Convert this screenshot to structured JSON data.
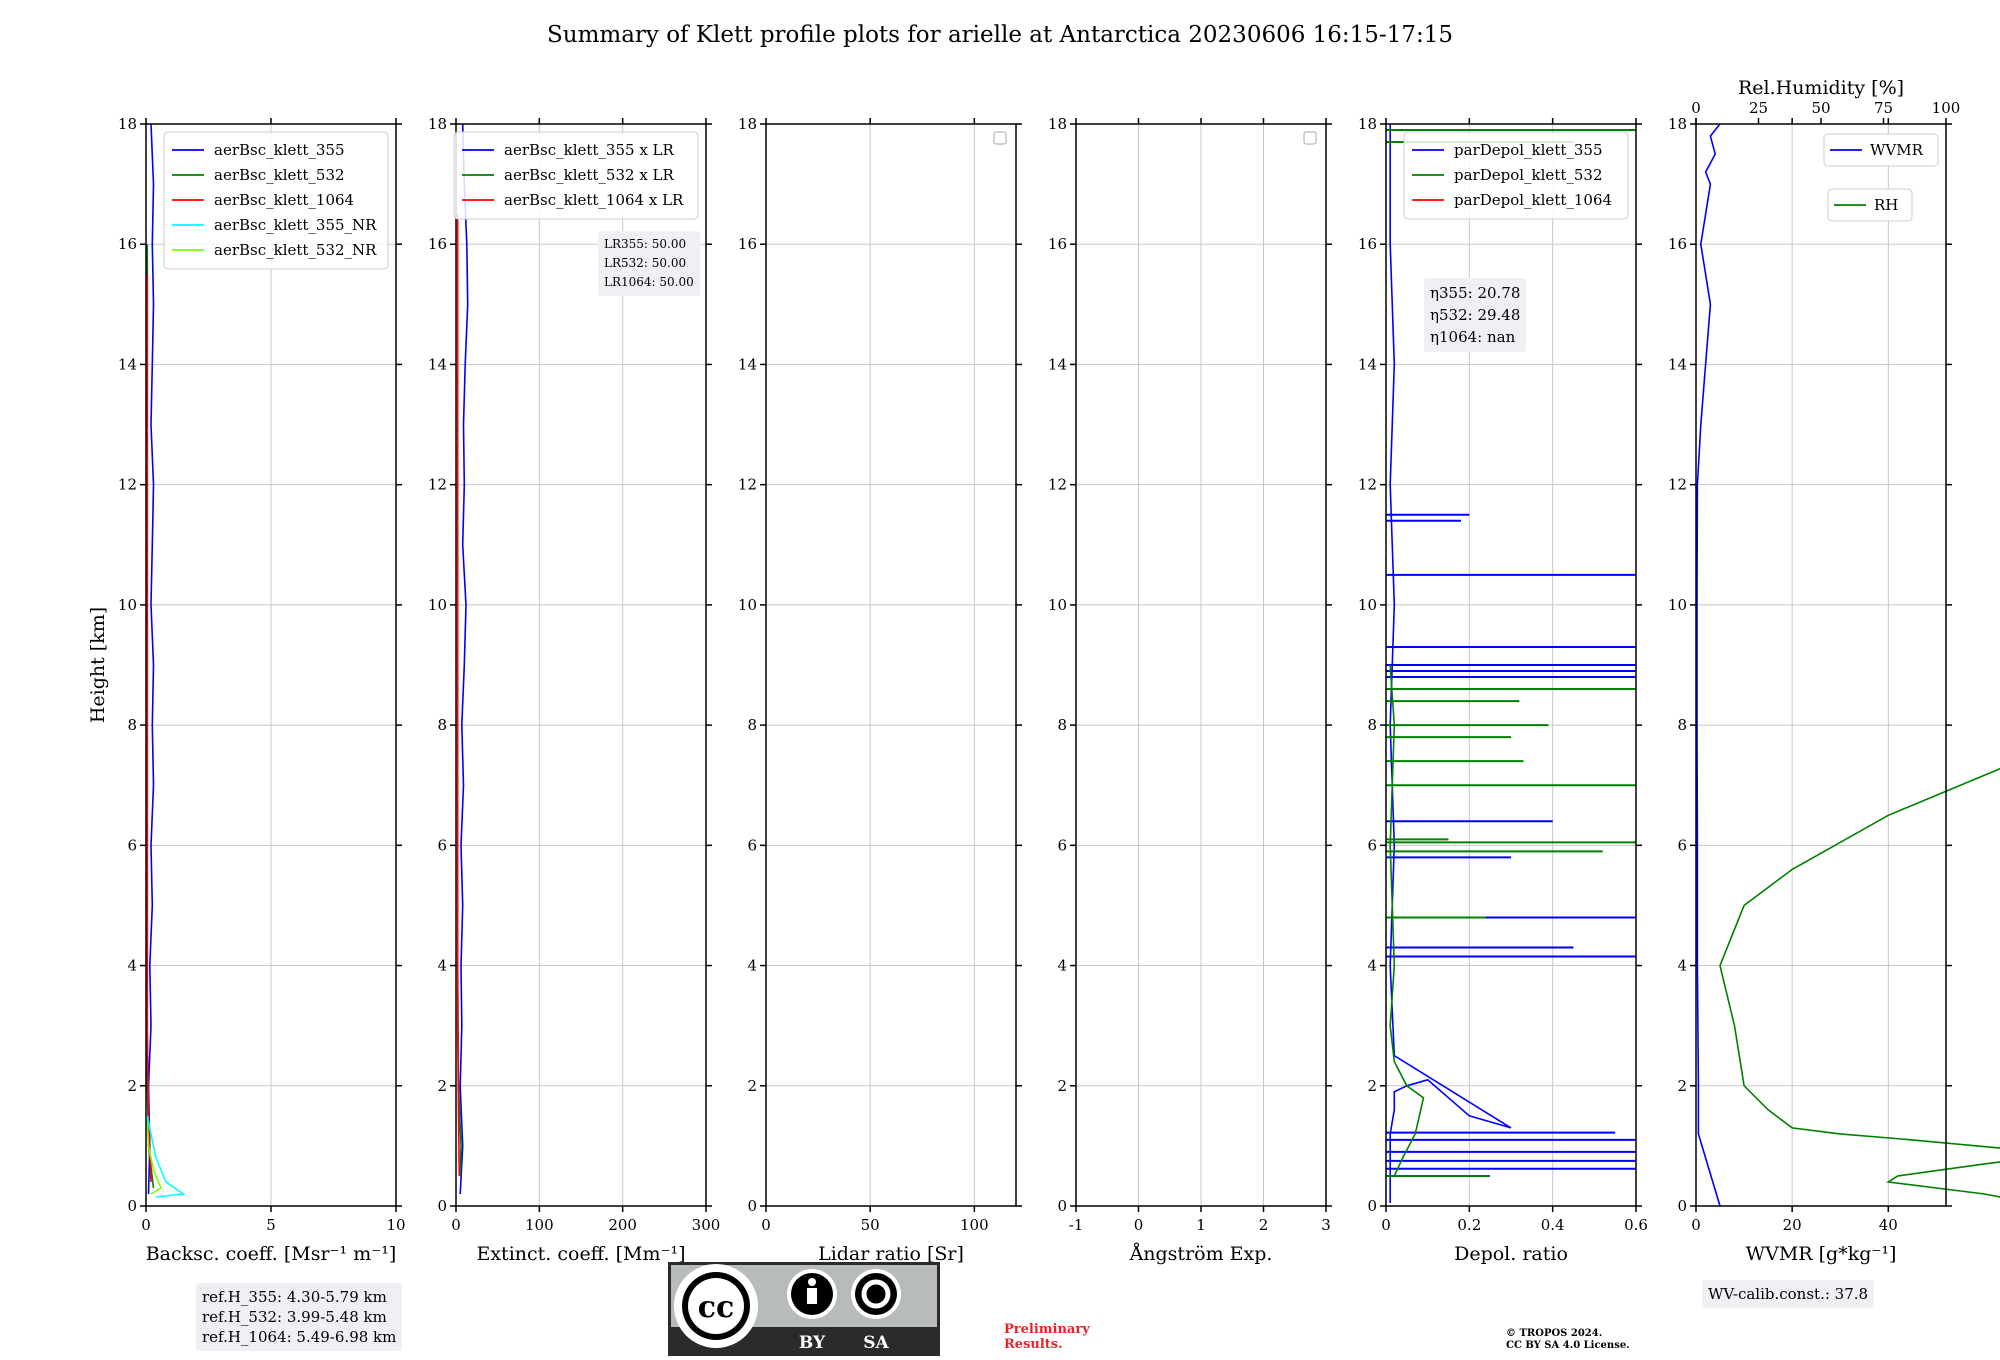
{
  "title": "Summary of Klett profile plots for arielle at Antarctica 20230606 16:15-17:15",
  "colors": {
    "c355": "#0000ff",
    "c532": "#008000",
    "c1064": "#ff0000",
    "c355nr": "#00ffff",
    "c532nr": "#7cfc00",
    "grid": "#c8c8c8"
  },
  "chart_data": [
    {
      "type": "line",
      "ylabel": "Height [km]",
      "xlabel": "Backsc. coeff. [Msr⁻¹ m⁻¹]",
      "xlim": [
        0,
        10
      ],
      "ylim": [
        0,
        18
      ],
      "xticks": [
        0,
        5,
        10
      ],
      "yticks": [
        0,
        2,
        4,
        6,
        8,
        10,
        12,
        14,
        16,
        18
      ],
      "legend": {
        "position": "top-right",
        "entries": [
          "aerBsc_klett_355",
          "aerBsc_klett_532",
          "aerBsc_klett_1064",
          "aerBsc_klett_355_NR",
          "aerBsc_klett_532_NR"
        ]
      },
      "series": [
        {
          "name": "aerBsc_klett_355",
          "color": "#0000ff",
          "x": [
            0.1,
            0.15,
            0.1,
            0.2,
            0.15,
            0.25,
            0.2,
            0.3,
            0.25,
            0.3,
            0.2,
            0.25,
            0.3,
            0.2,
            0.25,
            0.3,
            0.25,
            0.3,
            0.2
          ],
          "y": [
            0.2,
            1,
            2,
            3,
            4,
            5,
            6,
            7,
            8,
            9,
            10,
            11,
            12,
            13,
            14,
            15,
            16,
            17,
            18
          ]
        },
        {
          "name": "aerBsc_klett_532",
          "color": "#008000",
          "x": [
            0.3,
            0.1,
            0.05,
            0.05,
            0.05,
            0.05,
            0.05,
            0.05,
            0.05,
            0.05
          ],
          "y": [
            0.3,
            1,
            2,
            4,
            6,
            8,
            10,
            12,
            14,
            16
          ]
        },
        {
          "name": "aerBsc_klett_1064",
          "color": "#ff0000",
          "x": [
            0.2,
            0.1,
            0.05,
            0.05,
            0.05,
            0.05,
            0.05,
            0.05,
            0.05
          ],
          "y": [
            0.4,
            1.5,
            3,
            5,
            7,
            9,
            11,
            13,
            15.5
          ]
        },
        {
          "name": "aerBsc_klett_355_NR",
          "color": "#00ffff",
          "x": [
            0.4,
            1.5,
            0.8,
            0.4,
            0.2,
            0.05
          ],
          "y": [
            0.15,
            0.2,
            0.4,
            0.8,
            1.2,
            1.5
          ]
        },
        {
          "name": "aerBsc_klett_532_NR",
          "color": "#7cfc00",
          "x": [
            0.2,
            0.6,
            0.3,
            0.1,
            0.05
          ],
          "y": [
            0.2,
            0.3,
            0.6,
            1.0,
            1.4
          ]
        }
      ]
    },
    {
      "type": "line",
      "xlabel": "Extinct. coeff. [Mm⁻¹]",
      "xlim": [
        0,
        300
      ],
      "ylim": [
        0,
        18
      ],
      "xticks": [
        0,
        100,
        200,
        300
      ],
      "yticks": [
        0,
        2,
        4,
        6,
        8,
        10,
        12,
        14,
        16,
        18
      ],
      "legend": {
        "position": "top-right",
        "entries": [
          "aerBsc_klett_355 x LR",
          "aerBsc_klett_532 x LR",
          "aerBsc_klett_1064 x LR"
        ]
      },
      "series": [
        {
          "name": "aerBsc_klett_355 x LR",
          "color": "#0000ff",
          "x": [
            5,
            8,
            5,
            7,
            6,
            8,
            6,
            9,
            7,
            10,
            12,
            8,
            10,
            9,
            11,
            14,
            13,
            10,
            8
          ],
          "y": [
            0.2,
            1,
            2,
            3,
            4,
            5,
            6,
            7,
            8,
            9,
            10,
            11,
            12,
            13,
            14,
            15,
            16,
            17,
            18
          ]
        },
        {
          "name": "aerBsc_klett_532 x LR",
          "color": "#008000",
          "x": [
            5,
            6,
            3,
            2,
            2,
            2,
            2,
            2,
            2
          ],
          "y": [
            0.5,
            1,
            2,
            4,
            6,
            8,
            10,
            12,
            14
          ]
        },
        {
          "name": "aerBsc_klett_1064 x LR",
          "color": "#ff0000",
          "x": [
            4,
            3,
            2,
            2,
            2,
            2,
            2,
            2,
            2
          ],
          "y": [
            0.5,
            1.5,
            3,
            5,
            7,
            9,
            11,
            13,
            16.5
          ]
        }
      ]
    },
    {
      "type": "line",
      "xlabel": "Lidar ratio [Sr]",
      "xlim": [
        0,
        120
      ],
      "ylim": [
        0,
        18
      ],
      "xticks": [
        0,
        50,
        100
      ],
      "yticks": [
        0,
        2,
        4,
        6,
        8,
        10,
        12,
        14,
        16,
        18
      ],
      "legend": {
        "position": "top-right",
        "entries": []
      },
      "series": []
    },
    {
      "type": "line",
      "xlabel": "Ångström Exp.",
      "xlim": [
        -1,
        3
      ],
      "ylim": [
        0,
        18
      ],
      "xticks": [
        -1,
        0,
        1,
        2,
        3
      ],
      "yticks": [
        0,
        2,
        4,
        6,
        8,
        10,
        12,
        14,
        16,
        18
      ],
      "legend": {
        "position": "top-right",
        "entries": []
      },
      "series": []
    },
    {
      "type": "line",
      "xlabel": "Depol. ratio",
      "xlim": [
        0,
        0.6
      ],
      "ylim": [
        0,
        18
      ],
      "xticks": [
        0.0,
        0.2,
        0.4,
        0.6
      ],
      "yticks": [
        0,
        2,
        4,
        6,
        8,
        10,
        12,
        14,
        16,
        18
      ],
      "legend": {
        "position": "top-right",
        "entries": [
          "parDepol_klett_355",
          "parDepol_klett_532",
          "parDepol_klett_1064"
        ]
      },
      "series": [
        {
          "name": "parDepol_klett_355",
          "color": "#0000ff",
          "spikes": [
            [
              0.6,
              0.62
            ],
            [
              0.6,
              0.75
            ],
            [
              0.6,
              0.9
            ],
            [
              0.6,
              1.1
            ],
            [
              0.55,
              1.22
            ],
            [
              0.6,
              4.15
            ],
            [
              0.45,
              4.3
            ],
            [
              0.6,
              4.8
            ],
            [
              0.3,
              5.8
            ],
            [
              0.4,
              6.4
            ],
            [
              0.6,
              8.6
            ],
            [
              0.6,
              8.8
            ],
            [
              0.6,
              8.9
            ],
            [
              0.6,
              9.0
            ],
            [
              0.6,
              9.3
            ],
            [
              0.6,
              10.5
            ],
            [
              0.18,
              11.4
            ],
            [
              0.2,
              11.5
            ]
          ],
          "x": [
            0.01,
            0.01,
            0.02,
            0.02,
            0.05,
            0.1,
            0.2,
            0.3,
            0.02,
            0.01,
            0.02,
            0.01,
            0.02,
            0.01,
            0.02,
            0.01,
            0.01
          ],
          "y": [
            0.05,
            1.2,
            1.6,
            1.9,
            2.0,
            2.1,
            1.5,
            1.3,
            2.5,
            4,
            6,
            8,
            10,
            12,
            14,
            16,
            18
          ]
        },
        {
          "name": "parDepol_klett_532",
          "color": "#008000",
          "spikes": [
            [
              0.25,
              0.5
            ],
            [
              0.15,
              6.1
            ],
            [
              0.6,
              6.05
            ],
            [
              0.52,
              5.9
            ],
            [
              0.24,
              4.8
            ],
            [
              0.6,
              7.0
            ],
            [
              0.33,
              7.4
            ],
            [
              0.3,
              7.8
            ],
            [
              0.39,
              8.0
            ],
            [
              0.32,
              8.4
            ],
            [
              0.6,
              8.6
            ],
            [
              0.45,
              17.7
            ],
            [
              0.62,
              17.9
            ]
          ],
          "x": [
            0.02,
            0.04,
            0.07,
            0.09,
            0.05,
            0.02,
            0.01,
            0.02,
            0.01,
            0.02,
            0.01
          ],
          "y": [
            0.5,
            0.8,
            1.2,
            1.8,
            2.0,
            2.4,
            3,
            4,
            6,
            8,
            9
          ]
        },
        {
          "name": "parDepol_klett_1064",
          "color": "#ff0000",
          "x": [],
          "y": []
        }
      ]
    },
    {
      "type": "line",
      "xlabel": "WVMR [g*kg⁻¹]",
      "x2label": "Rel.Humidity [%]",
      "xlim": [
        0,
        52
      ],
      "x2lim": [
        0,
        100
      ],
      "ylim": [
        0,
        18
      ],
      "xticks": [
        0,
        20,
        40
      ],
      "x2ticks": [
        0,
        25,
        50,
        75,
        100
      ],
      "yticks": [
        0,
        2,
        4,
        6,
        8,
        10,
        12,
        14,
        16,
        18
      ],
      "legend": {
        "position": "top-right",
        "entries": [
          "WVMR",
          "RH"
        ]
      },
      "series": [
        {
          "name": "WVMR",
          "color": "#0000ff",
          "x": [
            5,
            0.5,
            0.5,
            0.3,
            0.3,
            0.2,
            0.2,
            0.3,
            1,
            2,
            3,
            1,
            2,
            3,
            2,
            4,
            3,
            5
          ],
          "y": [
            0,
            1.2,
            2,
            4,
            6,
            8,
            10,
            12,
            13,
            14,
            15,
            16,
            16.5,
            17,
            17.2,
            17.5,
            17.8,
            18
          ]
        },
        {
          "name": "RH",
          "color": "#008000",
          "x": [
            70,
            60,
            40,
            42,
            60,
            70,
            65,
            45,
            30,
            20,
            15,
            10,
            8,
            5,
            10,
            20,
            40,
            70,
            90,
            100,
            100,
            100,
            100,
            80
          ],
          "y": [
            0.05,
            0.2,
            0.4,
            0.5,
            0.7,
            0.8,
            0.95,
            1.1,
            1.2,
            1.3,
            1.6,
            2.0,
            3.0,
            4.0,
            5.0,
            5.6,
            6.5,
            7.5,
            8.5,
            9.0,
            9.8,
            10.5,
            11.5,
            12.0
          ]
        }
      ]
    }
  ],
  "info": {
    "ref_h": [
      "ref.H_355: 4.30-5.79 km",
      "ref.H_532: 3.99-5.48 km",
      "ref.H_1064: 5.49-6.98 km"
    ],
    "lr": [
      "LR355: 50.00",
      "LR532: 50.00",
      "LR1064: 50.00"
    ],
    "eta": [
      "η355: 20.78",
      "η532: 29.48",
      "η1064: nan"
    ],
    "wv_calib": "WV-calib.const.: 37.8"
  },
  "badge": {
    "cc": "cc",
    "by": "BY",
    "sa": "SA"
  },
  "preliminary": [
    "Preliminary",
    "Results."
  ],
  "copyright": [
    "© TROPOS 2024.",
    "CC BY SA 4.0 License."
  ]
}
